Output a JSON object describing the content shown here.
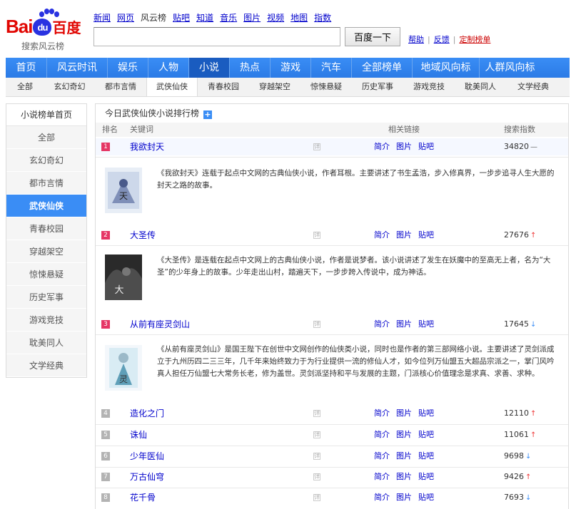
{
  "logo": {
    "brand_left": "Bai",
    "brand_du": "du",
    "brand_cn": "百度",
    "subtitle": "搜索风云榜"
  },
  "topnav": [
    "新闻",
    "网页",
    "风云榜",
    "贴吧",
    "知道",
    "音乐",
    "图片",
    "视频",
    "地图",
    "指数"
  ],
  "search": {
    "value": "",
    "button": "百度一下"
  },
  "helplinks": {
    "help": "帮助",
    "feedback": "反馈",
    "custom": "定制榜单"
  },
  "mainnav": [
    "首页",
    "风云时讯",
    "娱乐",
    "人物",
    "小说",
    "热点",
    "游戏",
    "汽车",
    "全部榜单",
    "地域风向标",
    "人群风向标"
  ],
  "subnav": [
    "全部",
    "玄幻奇幻",
    "都市言情",
    "武侠仙侠",
    "青春校园",
    "穿越架空",
    "惊悚悬疑",
    "历史军事",
    "游戏竞技",
    "耽美同人",
    "文学经典"
  ],
  "sidebar": {
    "head": "小说榜单首页",
    "items": [
      "全部",
      "玄幻奇幻",
      "都市言情",
      "武侠仙侠",
      "青春校园",
      "穿越架空",
      "惊悚悬疑",
      "历史军事",
      "游戏竞技",
      "耽美同人",
      "文学经典"
    ]
  },
  "panel": {
    "title": "今日武侠仙侠小说排行榜",
    "plus": "+",
    "columns": {
      "rank": "排名",
      "keyword": "关键词",
      "links": "相关链接",
      "index": "搜索指数"
    }
  },
  "rows": [
    {
      "rank": "1",
      "keyword": "我欲封天",
      "link1": "简介",
      "link2": "图片",
      "link3": "贴吧",
      "index": "34820",
      "trend": "—",
      "desc": "《我欲封天》连载于起点中文网的古典仙侠小说，作者耳根。主要讲述了书生孟浩，步入修真界，一步步追寻人生大愿的封天之路的故事。"
    },
    {
      "rank": "2",
      "keyword": "大圣传",
      "link1": "简介",
      "link2": "图片",
      "link3": "贴吧",
      "index": "27676",
      "trend": "↑",
      "desc": "《大圣传》是连载在起点中文网上的古典仙侠小说，作者是说梦者。该小说讲述了发生在妖魔中的至高无上者，名为“大圣”的少年身上的故事。少年走出山村，踏遍天下，一步步跨入传说中，成为神话。"
    },
    {
      "rank": "3",
      "keyword": "从前有座灵剑山",
      "link1": "简介",
      "link2": "图片",
      "link3": "贴吧",
      "index": "17645",
      "trend": "↓",
      "desc": "《从前有座灵剑山》是国王陛下在创世中文网创作的仙侠类小说，同时也是作者的第三部网络小说。主要讲述了灵剑派成立于九州历四二三三年，几千年来始终致力于为行业提供一流的修仙人才，如今位列万仙盟五大超品宗派之一，掌门风吟真人担任万仙盟七大常务长老，修为盖世。灵剑派坚持和平与发展的主题，门派核心价值理念是求真、求善、求种。"
    },
    {
      "rank": "4",
      "keyword": "造化之门",
      "link1": "简介",
      "link2": "图片",
      "link3": "贴吧",
      "index": "12110",
      "trend": "↑"
    },
    {
      "rank": "5",
      "keyword": "诛仙",
      "link1": "简介",
      "link2": "图片",
      "link3": "贴吧",
      "index": "11061",
      "trend": "↑"
    },
    {
      "rank": "6",
      "keyword": "少年医仙",
      "link1": "简介",
      "link2": "图片",
      "link3": "贴吧",
      "index": "9698",
      "trend": "↓"
    },
    {
      "rank": "7",
      "keyword": "万古仙穹",
      "link1": "简介",
      "link2": "图片",
      "link3": "贴吧",
      "index": "9426",
      "trend": "↑"
    },
    {
      "rank": "8",
      "keyword": "花千骨",
      "link1": "简介",
      "link2": "图片",
      "link3": "贴吧",
      "index": "7693",
      "trend": "↓"
    }
  ],
  "colors": {
    "nav_blue": "#3a8df5",
    "nav_active": "#1a5cc0",
    "rank_hot": "#e53665",
    "link": "#0000cc"
  }
}
